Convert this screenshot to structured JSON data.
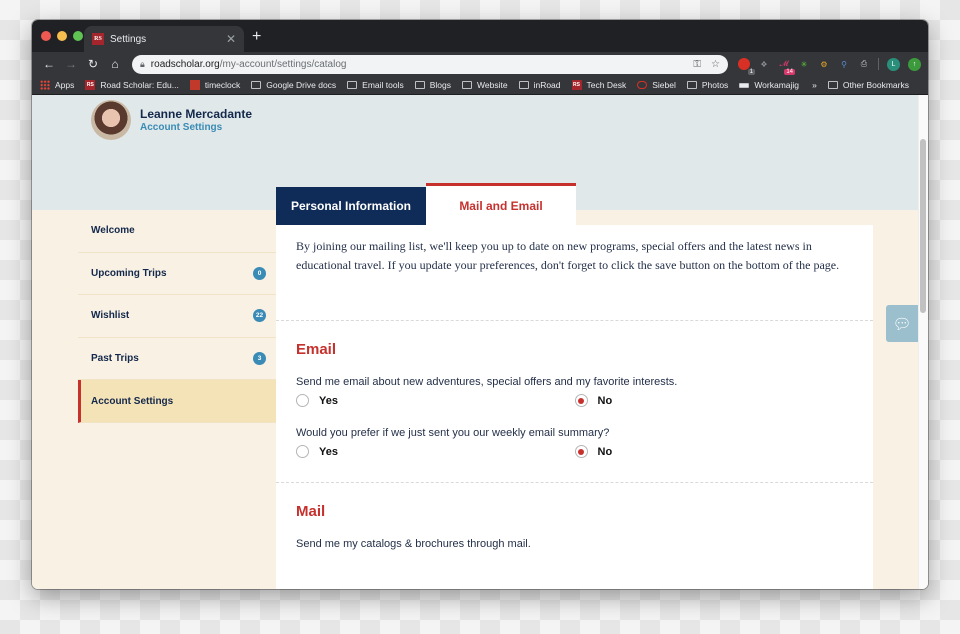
{
  "browser": {
    "tab": {
      "title": "Settings",
      "favicon": "RS"
    },
    "url_host": "roadscholar.org",
    "url_path": "/my-account/settings/catalog",
    "extensions": [
      {
        "icon": "red-extension-icon",
        "badge": "1",
        "color": "#d93025"
      },
      {
        "icon": "dropbox-icon",
        "color": "#8a8d91"
      },
      {
        "icon": "script-extension-icon",
        "badge": "14",
        "color": "#d6396b"
      },
      {
        "icon": "star-extension-icon",
        "color": "#5ec43a"
      },
      {
        "icon": "gear-extension-icon",
        "color": "#e8a92a"
      },
      {
        "icon": "key-extension-icon",
        "color": "#2c5ea8"
      },
      {
        "icon": "printer-extension-icon",
        "color": "#9aa0a6"
      }
    ],
    "profile_initial": "L",
    "bookmarks": [
      {
        "label": "Apps",
        "icon": "apps-grid-icon"
      },
      {
        "label": "Road Scholar: Edu...",
        "icon": "rs-favicon"
      },
      {
        "label": "timeclock",
        "icon": "timeclock-icon"
      },
      {
        "label": "Google Drive docs",
        "icon": "folder-icon"
      },
      {
        "label": "Email tools",
        "icon": "folder-icon"
      },
      {
        "label": "Blogs",
        "icon": "folder-icon"
      },
      {
        "label": "Website",
        "icon": "folder-icon"
      },
      {
        "label": "inRoad",
        "icon": "folder-icon"
      },
      {
        "label": "Tech Desk",
        "icon": "rs-favicon"
      },
      {
        "label": "Siebel",
        "icon": "siebel-icon"
      },
      {
        "label": "Photos",
        "icon": "folder-icon"
      },
      {
        "label": "Workamajig",
        "icon": "workamajig-icon"
      }
    ],
    "overflow_label": "»",
    "other_bookmarks": "Other Bookmarks"
  },
  "profile": {
    "name": "Leanne Mercadante",
    "subtitle": "Account Settings"
  },
  "sidebar": {
    "items": [
      {
        "label": "Welcome",
        "badge": null,
        "active": false
      },
      {
        "label": "Upcoming Trips",
        "badge": "0",
        "active": false
      },
      {
        "label": "Wishlist",
        "badge": "22",
        "active": false
      },
      {
        "label": "Past Trips",
        "badge": "3",
        "active": false
      },
      {
        "label": "Account Settings",
        "badge": null,
        "active": true
      }
    ]
  },
  "tabs": [
    {
      "label": "Personal Information",
      "active": false
    },
    {
      "label": "Mail and Email",
      "active": true
    }
  ],
  "content": {
    "intro": "By joining our mailing list, we'll keep you up to date on new programs, special offers and the latest news in educational travel. If you update your preferences, don't forget to click the save button on the bottom of the page.",
    "email": {
      "title": "Email",
      "questions": [
        {
          "text": "Send me email about new adventures, special offers and my favorite interests.",
          "yes": "Yes",
          "no": "No",
          "selected": "No"
        },
        {
          "text": "Would you prefer if we just sent you our weekly email summary?",
          "yes": "Yes",
          "no": "No",
          "selected": "No"
        }
      ]
    },
    "mail": {
      "title": "Mail",
      "question": "Send me my catalogs & brochures through mail."
    }
  },
  "colors": {
    "accent_red": "#c6312d",
    "navy": "#0f2b57",
    "link_blue": "#3a8bb5"
  }
}
